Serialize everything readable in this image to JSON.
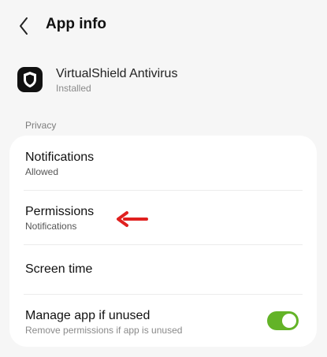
{
  "header": {
    "back_icon": "chevron-left-icon",
    "title": "App info"
  },
  "app": {
    "name": "VirtualShield Antivirus",
    "status": "Installed",
    "icon": "shield-icon"
  },
  "section": {
    "label": "Privacy"
  },
  "items": [
    {
      "title": "Notifications",
      "subtitle": "Allowed"
    },
    {
      "title": "Permissions",
      "subtitle": "Notifications"
    },
    {
      "title": "Screen time"
    },
    {
      "title": "Manage app if unused",
      "subtitle": "Remove permissions if app is unused",
      "toggle_on": true
    }
  ],
  "annotation": {
    "arrow_icon": "red-arrow-left-icon",
    "color": "#e0201f"
  },
  "colors": {
    "background": "#f6f6f6",
    "card": "#ffffff",
    "toggle_on": "#63b327"
  }
}
